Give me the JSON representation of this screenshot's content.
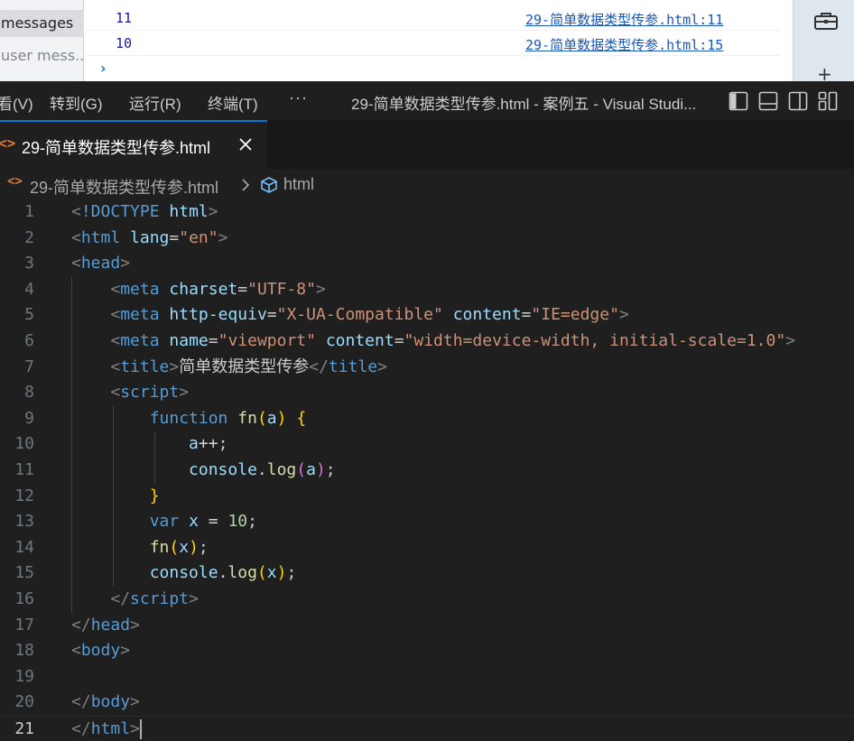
{
  "colors": {
    "editor_bg": "#1f1f1f",
    "accent": "#0078d4",
    "html_file_icon": "#e37933",
    "tag": "#569cd6",
    "attribute": "#9cdcfe",
    "string": "#ce9178",
    "function": "#dcdcaa",
    "number": "#b5cea8"
  },
  "devtools": {
    "sidebar": {
      "messages_label": "messages",
      "user_messages_label": "user mess..."
    },
    "console": {
      "rows": [
        {
          "value": "11",
          "source": "29-简单数据类型传参.html:11"
        },
        {
          "value": "10",
          "source": "29-简单数据类型传参.html:15"
        }
      ],
      "prompt_glyph": "›"
    },
    "rightbar_icons": [
      "toolbox-icon",
      "plus-icon"
    ]
  },
  "titlebar": {
    "menus": {
      "view": "看(V)",
      "goto": "转到(G)",
      "run": "运行(R)",
      "terminal": "终端(T)",
      "more": "···"
    },
    "window_title": "29-简单数据类型传参.html - 案例五 - Visual Studi...",
    "layout_icons": [
      "layout-sidebar-icon",
      "layout-panel-icon",
      "layout-secondary-icon",
      "customize-layout-icon"
    ]
  },
  "tab": {
    "icon_glyph": "<>",
    "label": "29-简单数据类型传参.html"
  },
  "breadcrumb": {
    "file_icon_glyph": "<>",
    "file": "29-简单数据类型传参.html",
    "symbol": "html"
  },
  "editor": {
    "current_line": 21,
    "lines": [
      {
        "n": "1",
        "tokens": [
          [
            "punc",
            "<"
          ],
          [
            "tag",
            "!DOCTYPE"
          ],
          [
            "text",
            " "
          ],
          [
            "attr",
            "html"
          ],
          [
            "punc",
            ">"
          ]
        ]
      },
      {
        "n": "2",
        "tokens": [
          [
            "punc",
            "<"
          ],
          [
            "tag",
            "html"
          ],
          [
            "text",
            " "
          ],
          [
            "attr",
            "lang"
          ],
          [
            "text",
            "="
          ],
          [
            "str",
            "\"en\""
          ],
          [
            "punc",
            ">"
          ]
        ]
      },
      {
        "n": "3",
        "tokens": [
          [
            "punc",
            "<"
          ],
          [
            "tag",
            "head"
          ],
          [
            "punc",
            ">"
          ]
        ]
      },
      {
        "n": "4",
        "tokens": [
          [
            "text",
            "    "
          ],
          [
            "punc",
            "<"
          ],
          [
            "tag",
            "meta"
          ],
          [
            "text",
            " "
          ],
          [
            "attr",
            "charset"
          ],
          [
            "text",
            "="
          ],
          [
            "str",
            "\"UTF-8\""
          ],
          [
            "punc",
            ">"
          ]
        ]
      },
      {
        "n": "5",
        "tokens": [
          [
            "text",
            "    "
          ],
          [
            "punc",
            "<"
          ],
          [
            "tag",
            "meta"
          ],
          [
            "text",
            " "
          ],
          [
            "attr",
            "http-equiv"
          ],
          [
            "text",
            "="
          ],
          [
            "str",
            "\"X-UA-Compatible\""
          ],
          [
            "text",
            " "
          ],
          [
            "attr",
            "content"
          ],
          [
            "text",
            "="
          ],
          [
            "str",
            "\"IE=edge\""
          ],
          [
            "punc",
            ">"
          ]
        ]
      },
      {
        "n": "6",
        "tokens": [
          [
            "text",
            "    "
          ],
          [
            "punc",
            "<"
          ],
          [
            "tag",
            "meta"
          ],
          [
            "text",
            " "
          ],
          [
            "attr",
            "name"
          ],
          [
            "text",
            "="
          ],
          [
            "str",
            "\"viewport\""
          ],
          [
            "text",
            " "
          ],
          [
            "attr",
            "content"
          ],
          [
            "text",
            "="
          ],
          [
            "str",
            "\"width=device-width, initial-scale=1.0\""
          ],
          [
            "punc",
            ">"
          ]
        ]
      },
      {
        "n": "7",
        "tokens": [
          [
            "text",
            "    "
          ],
          [
            "punc",
            "<"
          ],
          [
            "tag",
            "title"
          ],
          [
            "punc",
            ">"
          ],
          [
            "text",
            "简单数据类型传参"
          ],
          [
            "punc",
            "</"
          ],
          [
            "tag",
            "title"
          ],
          [
            "punc",
            ">"
          ]
        ]
      },
      {
        "n": "8",
        "tokens": [
          [
            "text",
            "    "
          ],
          [
            "punc",
            "<"
          ],
          [
            "tag",
            "script"
          ],
          [
            "punc",
            ">"
          ]
        ]
      },
      {
        "n": "9",
        "tokens": [
          [
            "text",
            "        "
          ],
          [
            "kw",
            "function"
          ],
          [
            "text",
            " "
          ],
          [
            "fn",
            "fn"
          ],
          [
            "br1",
            "("
          ],
          [
            "var",
            "a"
          ],
          [
            "br1",
            ")"
          ],
          [
            "text",
            " "
          ],
          [
            "br1",
            "{"
          ]
        ]
      },
      {
        "n": "10",
        "tokens": [
          [
            "text",
            "            "
          ],
          [
            "var",
            "a"
          ],
          [
            "op",
            "++"
          ],
          [
            "text",
            ";"
          ]
        ]
      },
      {
        "n": "11",
        "tokens": [
          [
            "text",
            "            "
          ],
          [
            "var",
            "console"
          ],
          [
            "text",
            "."
          ],
          [
            "fn",
            "log"
          ],
          [
            "br2",
            "("
          ],
          [
            "var",
            "a"
          ],
          [
            "br2",
            ")"
          ],
          [
            "text",
            ";"
          ]
        ]
      },
      {
        "n": "12",
        "tokens": [
          [
            "text",
            "        "
          ],
          [
            "br1",
            "}"
          ]
        ]
      },
      {
        "n": "13",
        "tokens": [
          [
            "text",
            "        "
          ],
          [
            "kw",
            "var"
          ],
          [
            "text",
            " "
          ],
          [
            "var",
            "x"
          ],
          [
            "text",
            " "
          ],
          [
            "op",
            "="
          ],
          [
            "text",
            " "
          ],
          [
            "num",
            "10"
          ],
          [
            "text",
            ";"
          ]
        ]
      },
      {
        "n": "14",
        "tokens": [
          [
            "text",
            "        "
          ],
          [
            "fn",
            "fn"
          ],
          [
            "br1",
            "("
          ],
          [
            "var",
            "x"
          ],
          [
            "br1",
            ")"
          ],
          [
            "text",
            ";"
          ]
        ]
      },
      {
        "n": "15",
        "tokens": [
          [
            "text",
            "        "
          ],
          [
            "var",
            "console"
          ],
          [
            "text",
            "."
          ],
          [
            "fn",
            "log"
          ],
          [
            "br1",
            "("
          ],
          [
            "var",
            "x"
          ],
          [
            "br1",
            ")"
          ],
          [
            "text",
            ";"
          ]
        ]
      },
      {
        "n": "16",
        "tokens": [
          [
            "text",
            "    "
          ],
          [
            "punc",
            "</"
          ],
          [
            "tag",
            "script"
          ],
          [
            "punc",
            ">"
          ]
        ]
      },
      {
        "n": "17",
        "tokens": [
          [
            "punc",
            "</"
          ],
          [
            "tag",
            "head"
          ],
          [
            "punc",
            ">"
          ]
        ]
      },
      {
        "n": "18",
        "tokens": [
          [
            "punc",
            "<"
          ],
          [
            "tag",
            "body"
          ],
          [
            "punc",
            ">"
          ]
        ]
      },
      {
        "n": "19",
        "tokens": []
      },
      {
        "n": "20",
        "tokens": [
          [
            "punc",
            "</"
          ],
          [
            "tag",
            "body"
          ],
          [
            "punc",
            ">"
          ]
        ]
      },
      {
        "n": "21",
        "tokens": [
          [
            "punc",
            "</"
          ],
          [
            "tag",
            "html"
          ],
          [
            "punc",
            ">"
          ]
        ]
      }
    ]
  }
}
